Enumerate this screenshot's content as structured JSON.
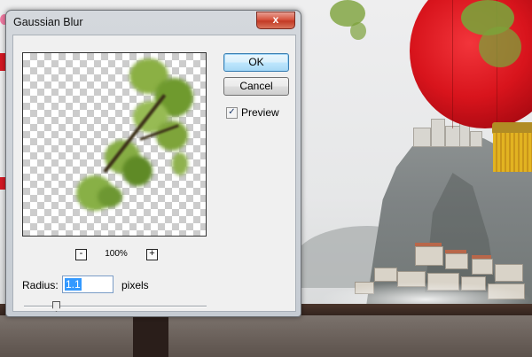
{
  "dialog": {
    "title": "Gaussian Blur",
    "close_label": "x",
    "ok_label": "OK",
    "cancel_label": "Cancel",
    "preview_label": "Preview",
    "preview_checked": true,
    "check_mark": "✓",
    "zoom_out_label": "-",
    "zoom_in_label": "+",
    "zoom_level": "100%",
    "radius_label": "Radius:",
    "radius_value": "1.1",
    "radius_unit": "pixels",
    "radius_slider_fraction": 0.06
  },
  "colors": {
    "lantern_red": "#d8141c",
    "foliage_green": "#7ca13a",
    "default_button_border": "#3c7fb1",
    "close_button_red": "#c33b25"
  },
  "icons": {
    "close": "close-icon",
    "check": "checkmark-icon"
  }
}
